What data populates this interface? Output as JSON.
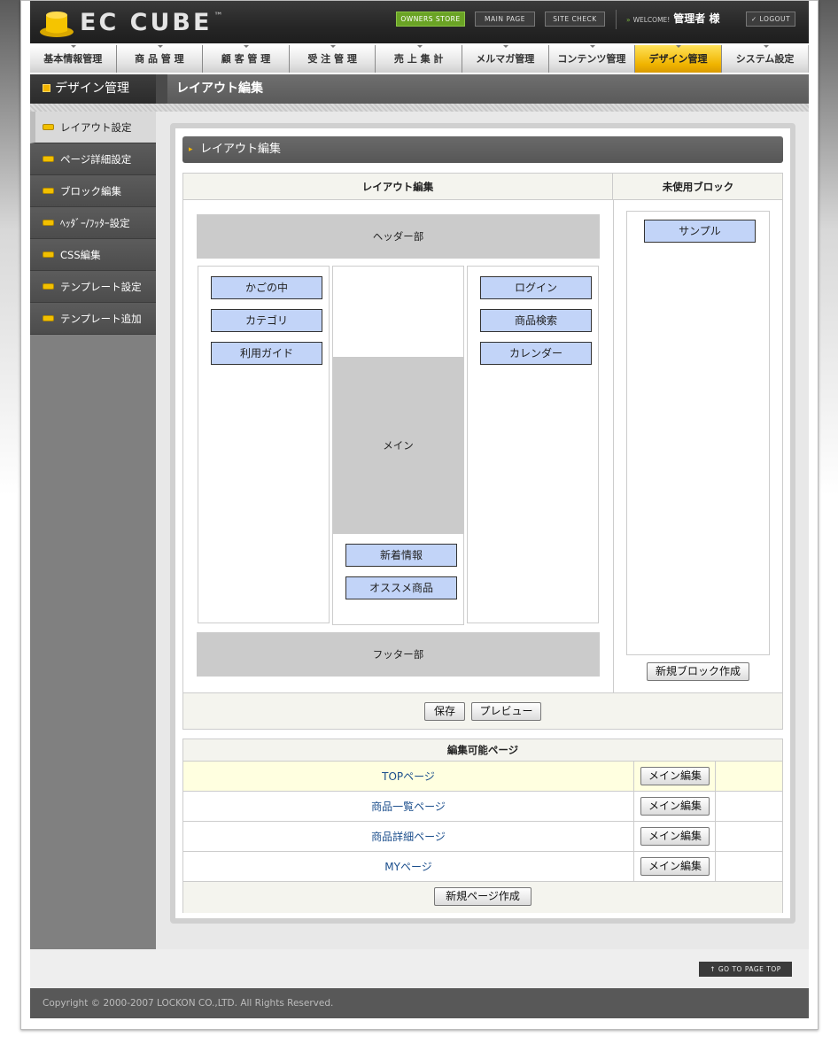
{
  "header": {
    "logo_text": "EC CUBE",
    "logo_tm": "™",
    "owners_store": "OWNERS STORE",
    "main_page": "MAIN PAGE",
    "site_check": "SITE CHECK",
    "welcome": "WELCOME!",
    "user": "管理者 様",
    "logout": "LOGOUT"
  },
  "nav": [
    {
      "label": "基本情報管理"
    },
    {
      "label": "商 品 管 理"
    },
    {
      "label": "顧 客 管 理"
    },
    {
      "label": "受 注 管 理"
    },
    {
      "label": "売 上 集 計"
    },
    {
      "label": "メルマガ管理"
    },
    {
      "label": "コンテンツ管理"
    },
    {
      "label": "デザイン管理",
      "active": true
    },
    {
      "label": "システム設定"
    }
  ],
  "subheader": {
    "section": "デザイン管理",
    "page": "レイアウト編集"
  },
  "sidebar": [
    {
      "label": "レイアウト設定",
      "active": true
    },
    {
      "label": "ページ詳細設定"
    },
    {
      "label": "ブロック編集"
    },
    {
      "label": "ﾍｯﾀﾞｰ/ﾌｯﾀｰ設定"
    },
    {
      "label": "CSS編集"
    },
    {
      "label": "テンプレート設定"
    },
    {
      "label": "テンプレート追加"
    }
  ],
  "panel": {
    "title": "レイアウト編集",
    "layout_header": "レイアウト編集",
    "unused_header": "未使用ブロック",
    "header_area": "ヘッダー部",
    "footer_area": "フッター部",
    "main_area": "メイン",
    "left_blocks": [
      "かごの中",
      "カテゴリ",
      "利用ガイド"
    ],
    "center_blocks": [
      "新着情報",
      "オススメ商品"
    ],
    "right_blocks": [
      "ログイン",
      "商品検索",
      "カレンダー"
    ],
    "unused_blocks": [
      "サンプル"
    ],
    "new_block_button": "新規ブロック作成",
    "save_button": "保存",
    "preview_button": "プレビュー"
  },
  "pages": {
    "header": "編集可能ページ",
    "edit_label": "メイン編集",
    "rows": [
      {
        "name": "TOPページ"
      },
      {
        "name": "商品一覧ページ"
      },
      {
        "name": "商品詳細ページ"
      },
      {
        "name": "MYページ"
      }
    ],
    "new_page_button": "新規ページ作成"
  },
  "footer": {
    "go_top": "GO TO PAGE TOP",
    "copyright": "Copyright © 2000-2007 LOCKON CO.,LTD. All Rights Reserved."
  }
}
